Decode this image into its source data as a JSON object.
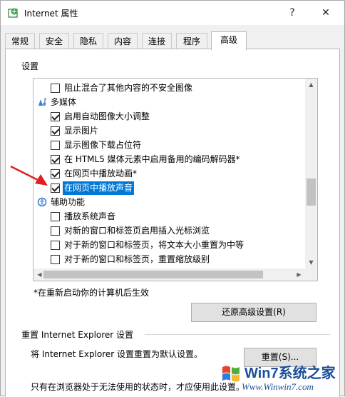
{
  "window": {
    "title": "Internet 属性",
    "help_button": "?",
    "close_button": "✕"
  },
  "tabs": [
    "常规",
    "安全",
    "隐私",
    "内容",
    "连接",
    "程序",
    "高级"
  ],
  "active_tab": "高级",
  "settings": {
    "group_label": "设置",
    "rows": [
      {
        "type": "checkbox",
        "checked": false,
        "label": "阻止混合了其他内容的不安全图像"
      },
      {
        "type": "category",
        "icon": "multimedia-icon",
        "label": "多媒体"
      },
      {
        "type": "checkbox",
        "checked": true,
        "label": "启用自动图像大小调整"
      },
      {
        "type": "checkbox",
        "checked": true,
        "label": "显示图片"
      },
      {
        "type": "checkbox",
        "checked": false,
        "label": "显示图像下载占位符"
      },
      {
        "type": "checkbox",
        "checked": true,
        "label": "在 HTML5 媒体元素中启用备用的编码解码器*"
      },
      {
        "type": "checkbox",
        "checked": true,
        "label": "在网页中播放动画*"
      },
      {
        "type": "checkbox",
        "checked": true,
        "label": "在网页中播放声音",
        "selected": true
      },
      {
        "type": "category",
        "icon": "accessibility-icon",
        "label": "辅助功能"
      },
      {
        "type": "checkbox",
        "checked": false,
        "label": "播放系统声音"
      },
      {
        "type": "checkbox",
        "checked": false,
        "label": "对新的窗口和标签页启用插入光标浏览"
      },
      {
        "type": "checkbox",
        "checked": false,
        "label": "对于新的窗口和标签页，将文本大小重置为中等"
      },
      {
        "type": "checkbox",
        "checked": false,
        "label": "对于新的窗口和标签页，重置缩放级别"
      }
    ],
    "restart_note": "*在重新启动你的计算机后生效",
    "restore_button": "还原高级设置(R)"
  },
  "reset": {
    "group_label": "重置 Internet Explorer 设置",
    "description": "将 Internet Explorer 设置重置为默认设置。",
    "reset_button": "重置(S)...",
    "note": "只有在浏览器处于无法使用的状态时，才应使用此设置。"
  },
  "watermark": {
    "title": "Win7系统之家",
    "url": "Www.Winwin7.com"
  },
  "colors": {
    "selection": "#0078d7",
    "annotation_arrow": "#e02020",
    "watermark": "#1a4f9c"
  }
}
